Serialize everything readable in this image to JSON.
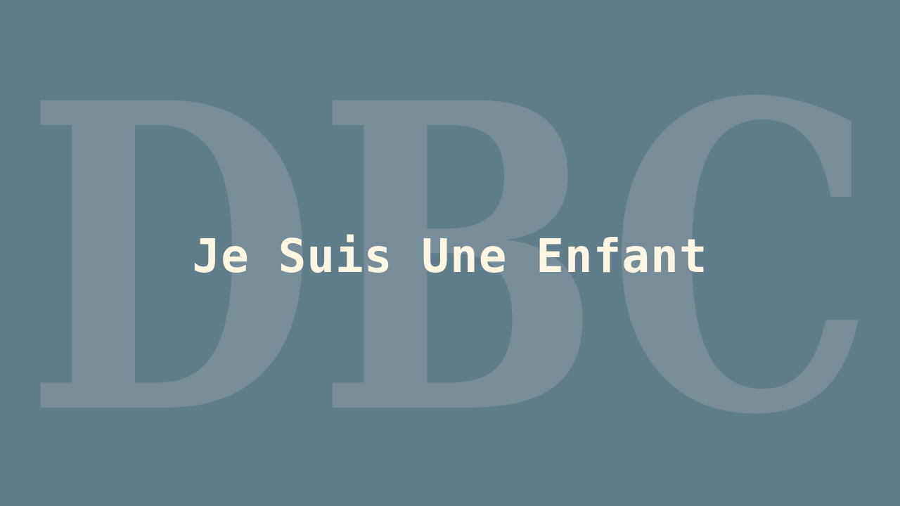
{
  "slide": {
    "background_color": "#607d8b",
    "watermark": {
      "text": "DBC",
      "color": "#778d9a"
    },
    "title": {
      "text": "Je Suis Une Enfant",
      "color": "#fdf6e3"
    }
  }
}
